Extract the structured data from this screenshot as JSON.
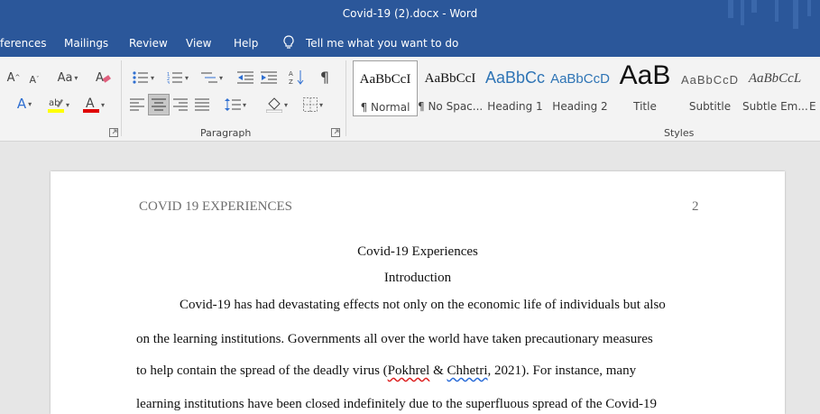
{
  "window": {
    "title": "Covid-19 (2).docx  -  Word"
  },
  "menu": {
    "tabs": [
      "ferences",
      "Mailings",
      "Review",
      "View",
      "Help"
    ],
    "tell_me": "Tell me what you want to do"
  },
  "ribbon": {
    "paragraph_label": "Paragraph",
    "styles_label": "Styles",
    "font_case_label": "Aa",
    "styles": [
      {
        "sample": "AaBbCcI",
        "name": "¶ Normal"
      },
      {
        "sample": "AaBbCcI",
        "name": "¶ No Spac..."
      },
      {
        "sample": "AaBbCc",
        "name": "Heading 1"
      },
      {
        "sample": "AaBbCcD",
        "name": "Heading 2"
      },
      {
        "sample": "AaB",
        "name": "Title"
      },
      {
        "sample": "AaBbCcD",
        "name": "Subtitle"
      },
      {
        "sample": "AaBbCcL",
        "name": "Subtle Em..."
      },
      {
        "sample": "",
        "name": "E"
      }
    ],
    "colors": {
      "highlight": "#ffff00",
      "font_color": "#e00000"
    }
  },
  "document": {
    "running_head": "COVID 19 EXPERIENCES",
    "page_number": "2",
    "title": "Covid-19 Experiences",
    "section": "Introduction",
    "lines": {
      "l1": "Covid-19 has had devastating effects not only on the economic life of individuals but also",
      "l2": "on the learning institutions. Governments all over the world have taken precautionary measures",
      "l3a": "to help contain the spread of the deadly virus (",
      "l3_cite1": "Pokhrel",
      "l3b": " & ",
      "l3_cite2": "Chhetri",
      "l3c": ", 2021). For instance, many",
      "l4": "learning institutions have been closed indefinitely due to the superfluous spread of the Covid-19"
    }
  }
}
